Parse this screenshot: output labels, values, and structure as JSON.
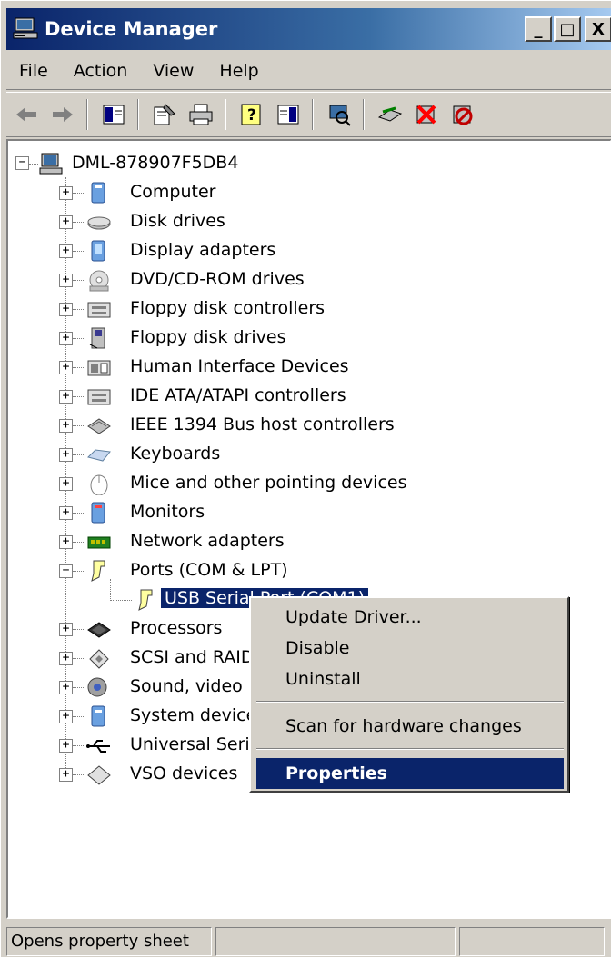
{
  "window": {
    "title": "Device Manager"
  },
  "caption_buttons": {
    "minimize": "_",
    "maximize": "□",
    "close": "X"
  },
  "menu": [
    "File",
    "Action",
    "View",
    "Help"
  ],
  "toolbar_icons": [
    "back-arrow-icon",
    "forward-arrow-icon",
    "show-hide-console-tree-icon",
    "properties-icon",
    "print-icon",
    "help-icon",
    "show-hide-action-pane-icon",
    "scan-hardware-icon",
    "update-driver-icon",
    "uninstall-icon",
    "disable-icon"
  ],
  "tree": {
    "root": "DML-878907F5DB4",
    "items": [
      {
        "label": "Computer",
        "icon": "computer-icon",
        "expander": "+"
      },
      {
        "label": "Disk drives",
        "icon": "disk-drive-icon",
        "expander": "+"
      },
      {
        "label": "Display adapters",
        "icon": "display-adapter-icon",
        "expander": "+"
      },
      {
        "label": "DVD/CD-ROM drives",
        "icon": "dvd-drive-icon",
        "expander": "+"
      },
      {
        "label": "Floppy disk controllers",
        "icon": "floppy-controller-icon",
        "expander": "+"
      },
      {
        "label": "Floppy disk drives",
        "icon": "floppy-drive-icon",
        "expander": "+"
      },
      {
        "label": "Human Interface Devices",
        "icon": "hid-icon",
        "expander": "+"
      },
      {
        "label": "IDE ATA/ATAPI controllers",
        "icon": "ide-controller-icon",
        "expander": "+"
      },
      {
        "label": "IEEE 1394 Bus host controllers",
        "icon": "ieee1394-icon",
        "expander": "+"
      },
      {
        "label": "Keyboards",
        "icon": "keyboard-icon",
        "expander": "+"
      },
      {
        "label": "Mice and other pointing devices",
        "icon": "mouse-icon",
        "expander": "+"
      },
      {
        "label": "Monitors",
        "icon": "monitor-icon",
        "expander": "+"
      },
      {
        "label": "Network adapters",
        "icon": "network-adapter-icon",
        "expander": "+"
      },
      {
        "label": "Ports (COM & LPT)",
        "icon": "port-icon",
        "expander": "−"
      },
      {
        "label": "USB Serial Port (COM1)",
        "icon": "port-icon",
        "expander": ""
      },
      {
        "label": "Processors",
        "icon": "processor-icon",
        "expander": "+"
      },
      {
        "label": "SCSI and RAID",
        "icon": "scsi-icon",
        "expander": "+"
      },
      {
        "label": "Sound, video a",
        "icon": "sound-icon",
        "expander": "+"
      },
      {
        "label": "System device",
        "icon": "system-device-icon",
        "expander": "+"
      },
      {
        "label": "Universal Seria",
        "icon": "usb-icon",
        "expander": "+"
      },
      {
        "label": "VSO devices",
        "icon": "vso-icon",
        "expander": "+"
      }
    ]
  },
  "context_menu": {
    "update_driver": "Update Driver...",
    "disable": "Disable",
    "uninstall": "Uninstall",
    "scan": "Scan for hardware changes",
    "properties": "Properties"
  },
  "status": {
    "text": "Opens property sheet",
    "pane2": "",
    "pane3": ""
  },
  "colors": {
    "selection": "#0a246a",
    "window_bg": "#d4d0c8",
    "title_start": "#0a246a",
    "title_end": "#a6caf0"
  }
}
